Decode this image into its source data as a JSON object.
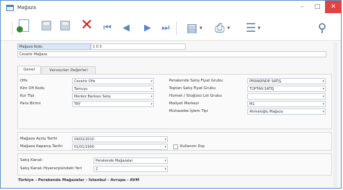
{
  "window": {
    "title": "Mağaza"
  },
  "toolbar": {
    "buttons": [
      "new-icon",
      "save-icon",
      "save-as-icon",
      "delete-icon",
      "first-icon",
      "prev-icon",
      "next-icon",
      "last-icon",
      "report-icon",
      "print-icon",
      "list-icon",
      "search-binoculars-icon"
    ]
  },
  "header": {
    "code_label": "Mağaza Kodu",
    "code_value": "1 0 3",
    "name_value": "Cevahir Mağaza"
  },
  "tabs": [
    "Genel",
    "Varsayılan Değerleri"
  ],
  "left_fields": [
    {
      "label": "Ofis",
      "value": "Cevahir Ofis"
    },
    {
      "label": "Kim Ofi Kodu",
      "value": "Tamuyu"
    },
    {
      "label": "Kur Tipi",
      "value": "Merkez Bankası Satış"
    },
    {
      "label": "Para Birimi",
      "value": "TRY"
    }
  ],
  "right_fields": [
    {
      "label": "Perakende Satış Fiyat Grubu",
      "value": "PERAKENDE SATIŞ"
    },
    {
      "label": "Toptan Satış Fiyat Grubu",
      "value": "TOPTAN SATIŞ"
    },
    {
      "label": "Hizmet / Stoğüsü Lot Grubu",
      "value": ""
    },
    {
      "label": "Maliyet Merkezi",
      "value": "M1"
    },
    {
      "label": "Muhasebe İşlem Tipi",
      "value": "Ahmetoğlu Mağaza"
    }
  ],
  "dates": [
    {
      "label": "Mağaza Açılış Tarihi",
      "value": "04/02/2010"
    },
    {
      "label": "Mağaza Kapanış Tarihi",
      "value": "01/01/1900"
    }
  ],
  "checkbox": {
    "label": "Kullanım Dışı",
    "checked": false
  },
  "channel": [
    {
      "label": "Satış Kanalı",
      "value": "Perakende Mağazalar"
    },
    {
      "label": "Satış Kanalı Hiyerarşisindeki Yeri",
      "value": "2"
    }
  ],
  "footer_path": "Türkiye - Perakende Mağazalar - İstanbul - Avrupa - AVM",
  "colors": {
    "accent": "#5a8fc4",
    "delete_red": "#d41f1f",
    "close_red": "#e04343"
  }
}
